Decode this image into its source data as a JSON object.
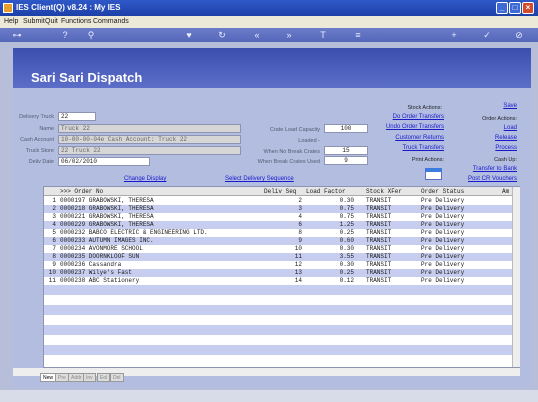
{
  "window": {
    "title": "IES Client(Q) v8.24 : My IES"
  },
  "menu": [
    "Help",
    "Submit",
    "Quit",
    "Functions",
    "Commands"
  ],
  "page": {
    "title": "Sari Sari Dispatch"
  },
  "form": {
    "delivery_truck_label": "Delivery Truck",
    "delivery_truck_value": "22",
    "name_label": "Name",
    "name_value": "Truck 22",
    "cash_account_label": "Cash Account",
    "cash_account_value": "10-00-00-04e Cash Account: Truck 22",
    "truck_store_label": "Truck Store",
    "truck_store_value": "22 Truck 22",
    "deliv_date_label": "Deliv Date",
    "deliv_date_value": "06/02/2010",
    "crate_load_capacity_label": "Crate Load Capacity",
    "crate_load_capacity_value": "100",
    "loaded_label": "Loaded -",
    "when_no_break_crates_label": "When No Break Crates",
    "when_no_break_crates_value": "15",
    "when_break_crates_used_label": "When Break Crates Used",
    "when_break_crates_used_value": "9"
  },
  "stock_actions": {
    "label": "Stock Actions:",
    "do_order_transfers": "Do Order Transfers",
    "undo_order_transfers": "Undo Order Transfers",
    "customer_returns": "Customer Returns",
    "truck_transfers": "Truck Transfers"
  },
  "order_actions": {
    "save": "Save",
    "label": "Order Actions:",
    "load": "Load",
    "release": "Release",
    "process": "Process"
  },
  "print_actions": {
    "label": "Print Actions:"
  },
  "cash": {
    "label": "Cash Up:",
    "transfer_to_bank": "Transfer to Bank",
    "post_cr_vouchers": "Post CR Vouchers"
  },
  "links": {
    "change_display": "Change Display",
    "select_delivery_sequence": "Select Delivery Sequence"
  },
  "grid": {
    "headers": [
      ">>> Order No",
      "Deliv Seq",
      "Load Factor",
      "Stock XFer",
      "Order Status",
      "Am"
    ],
    "rows": [
      {
        "n": "1",
        "order": "0000197 GRABOWSKI, THERESA",
        "seq": "2",
        "load": "0.30",
        "xfer": "TRANSIT",
        "status": "Pre Delivery"
      },
      {
        "n": "2",
        "order": "0000218 GRABOWSKI, THERESA",
        "seq": "3",
        "load": "0.75",
        "xfer": "TRANSIT",
        "status": "Pre Delivery"
      },
      {
        "n": "3",
        "order": "0000221 GRABOWSKI, THERESA",
        "seq": "4",
        "load": "0.75",
        "xfer": "TRANSIT",
        "status": "Pre Delivery"
      },
      {
        "n": "4",
        "order": "0000229 GRABOWSKI, THERESA",
        "seq": "6",
        "load": "1.25",
        "xfer": "TRANSIT",
        "status": "Pre Delivery"
      },
      {
        "n": "5",
        "order": "0000232 BABCO ELECTRIC & ENGINEERING LTD.",
        "seq": "8",
        "load": "0.25",
        "xfer": "TRANSIT",
        "status": "Pre Delivery"
      },
      {
        "n": "6",
        "order": "0000233 AUTUMN IMAGES INC.",
        "seq": "9",
        "load": "0.60",
        "xfer": "TRANSIT",
        "status": "Pre Delivery"
      },
      {
        "n": "7",
        "order": "0000234 AVONMORE SCHOOL",
        "seq": "10",
        "load": "0.30",
        "xfer": "TRANSIT",
        "status": "Pre Delivery"
      },
      {
        "n": "8",
        "order": "0000235 DOORNKLOOF SUN",
        "seq": "11",
        "load": "3.55",
        "xfer": "TRANSIT",
        "status": "Pre Delivery"
      },
      {
        "n": "9",
        "order": "0000236 Cassandra",
        "seq": "12",
        "load": "0.30",
        "xfer": "TRANSIT",
        "status": "Pre Delivery"
      },
      {
        "n": "10",
        "order": "0000237 Wilye's Fast",
        "seq": "13",
        "load": "0.25",
        "xfer": "TRANSIT",
        "status": "Pre Delivery"
      },
      {
        "n": "11",
        "order": "0000238 ABC Stationery",
        "seq": "14",
        "load": "0.12",
        "xfer": "TRANSIT",
        "status": "Pre Delivery"
      }
    ]
  },
  "tabs": [
    "New",
    "Pre",
    "Addr",
    "Inv",
    "Eol",
    "Del"
  ]
}
